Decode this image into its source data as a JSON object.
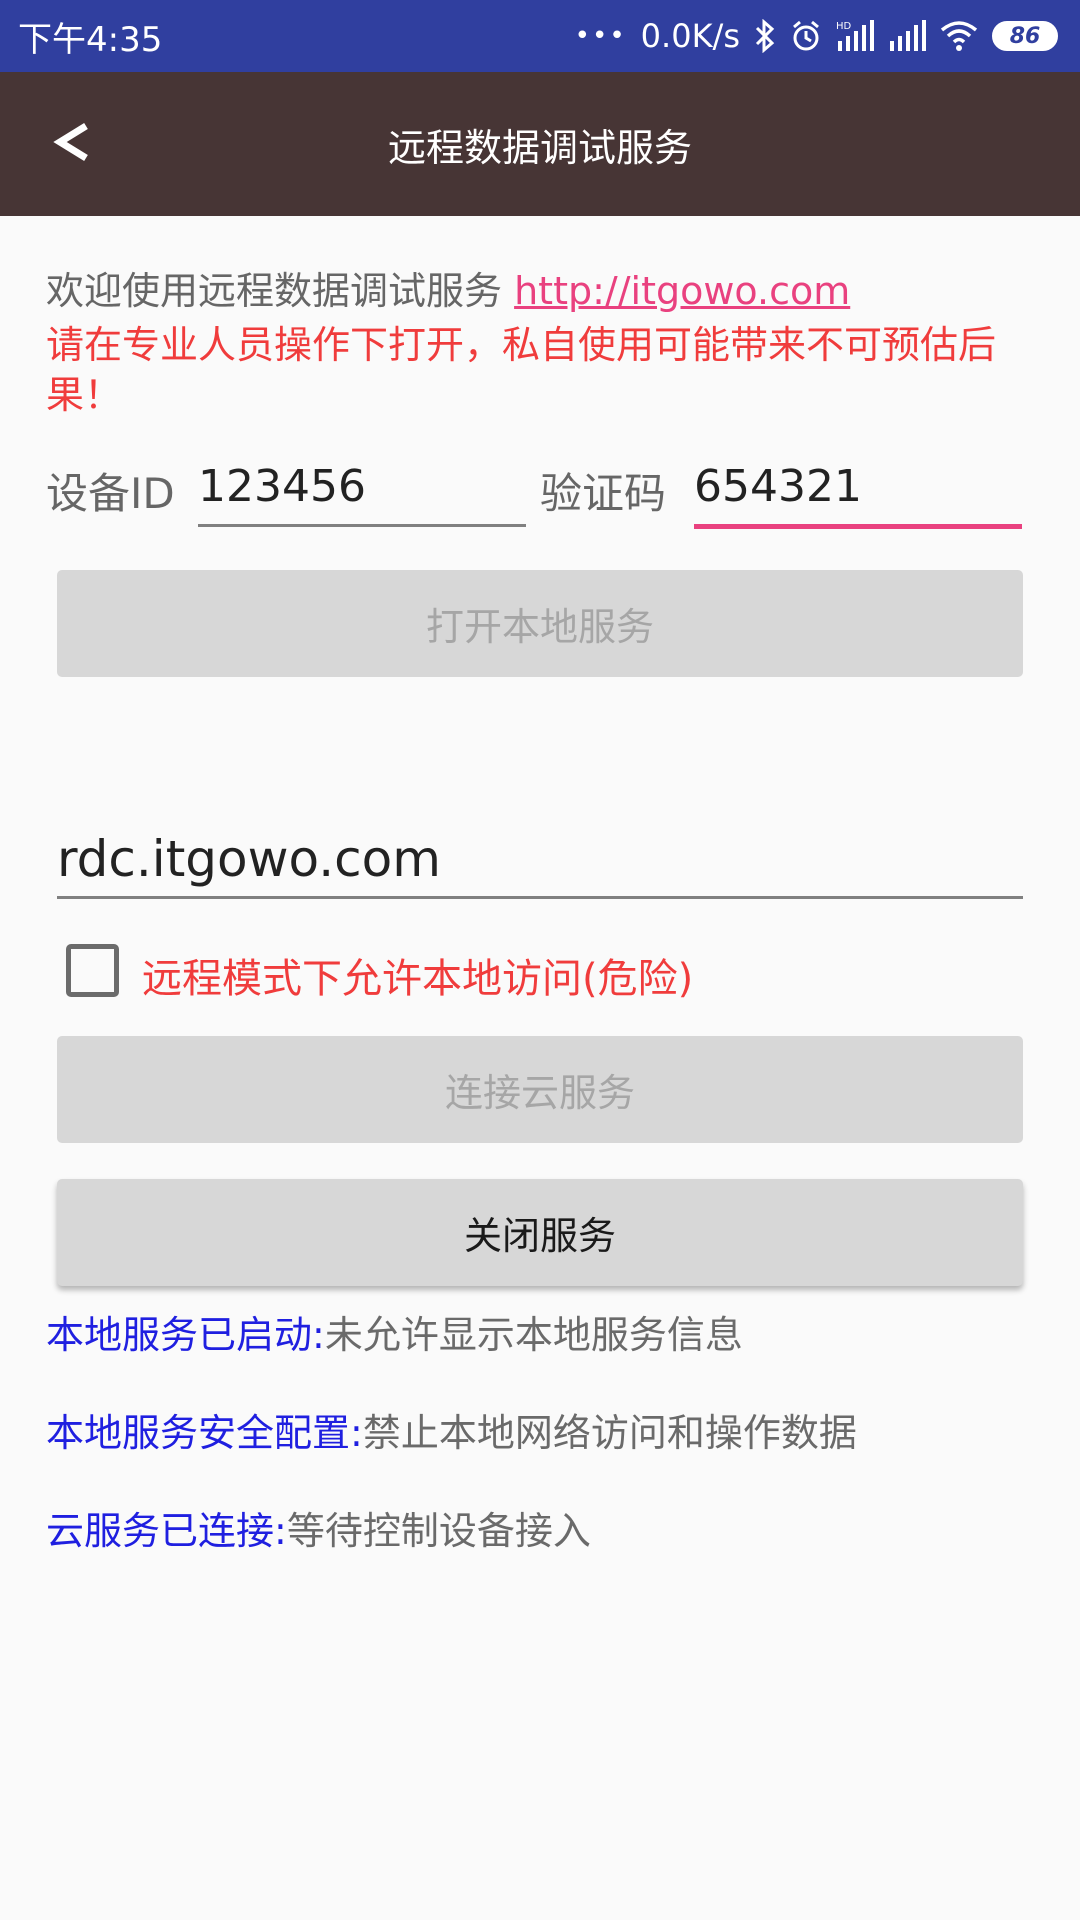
{
  "status_bar": {
    "time": "下午4:35",
    "more_dots": "•••",
    "network_speed": "0.0K/s",
    "battery_level": "86",
    "icons": [
      "bluetooth-icon",
      "alarm-icon",
      "hd-signal-icon",
      "signal-icon",
      "wifi-icon",
      "battery-icon"
    ]
  },
  "toolbar": {
    "back_label": "<",
    "title": "远程数据调试服务"
  },
  "welcome": {
    "text": "欢迎使用远程数据调试服务 ",
    "link": "http://itgowo.com",
    "warning": "请在专业人员操作下打开，私自使用可能带来不可预估后果！"
  },
  "device": {
    "id_label": "设备ID",
    "id_value": "123456",
    "code_label": "验证码",
    "code_value": "654321"
  },
  "buttons": {
    "open_local": "打开本地服务",
    "connect_cloud": "连接云服务",
    "close_service": "关闭服务"
  },
  "server": {
    "address": "rdc.itgowo.com"
  },
  "checkbox": {
    "label": "远程模式下允许本地访问(危险)",
    "checked": false
  },
  "info": [
    {
      "key": "本地服务已启动:",
      "value": "未允许显示本地服务信息"
    },
    {
      "key": "本地服务安全配置:",
      "value": "禁止本地网络访问和操作数据"
    },
    {
      "key": "云服务已连接:",
      "value": "等待控制设备接入"
    }
  ],
  "colors": {
    "status_bar": "#303f9f",
    "toolbar": "#473535",
    "accent": "#e9417f",
    "warning": "#f03c3c",
    "info_key": "#1f1fe0"
  }
}
